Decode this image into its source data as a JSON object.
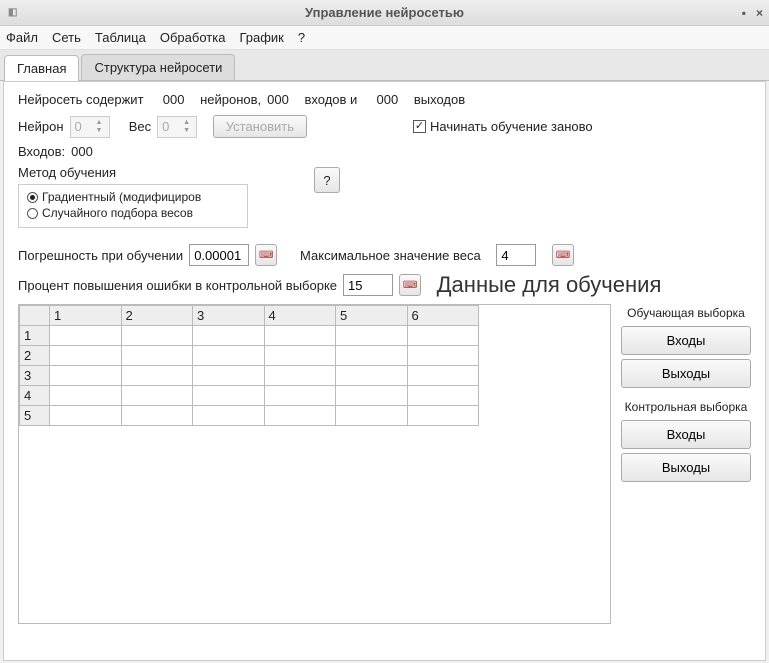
{
  "window": {
    "title": "Управление нейросетью"
  },
  "menu": {
    "file": "Файл",
    "network": "Сеть",
    "table": "Таблица",
    "processing": "Обработка",
    "chart": "График",
    "help": "?"
  },
  "tabs": {
    "main": "Главная",
    "structure": "Структура нейросети"
  },
  "summary": {
    "prefix": "Нейросеть содержит",
    "neurons": "000",
    "neurons_word": "нейронов,",
    "inputs": "000",
    "inputs_word": "входов и",
    "outputs": "000",
    "outputs_word": "выходов"
  },
  "neuron_row": {
    "neuron_label": "Нейрон",
    "neuron_value": "0",
    "weight_label": "Вес",
    "weight_value": "0",
    "set_button": "Установить"
  },
  "restart_checkbox": {
    "label": "Начинать обучение заново",
    "checked": true
  },
  "inputs_count": {
    "label": "Входов:",
    "value": "000"
  },
  "method": {
    "label": "Метод обучения",
    "help": "?",
    "option_gradient": "Градиентный (модифициров",
    "option_random": "Случайного подбора весов",
    "selected": "gradient"
  },
  "error_row": {
    "label": "Погрешность при обучении",
    "value": "0.00001"
  },
  "maxweight_row": {
    "label": "Максимальное значение веса",
    "value": "4"
  },
  "percent_row": {
    "label": "Процент повышения ошибки в контрольной выборке",
    "value": "15"
  },
  "data_heading": "Данные для обучения",
  "table": {
    "columns": [
      "",
      "1",
      "2",
      "3",
      "4",
      "5",
      "6"
    ],
    "rows": [
      "1",
      "2",
      "3",
      "4",
      "5"
    ]
  },
  "side": {
    "training_label": "Обучающая выборка",
    "control_label": "Контрольная выборка",
    "inputs_btn": "Входы",
    "outputs_btn": "Выходы"
  }
}
